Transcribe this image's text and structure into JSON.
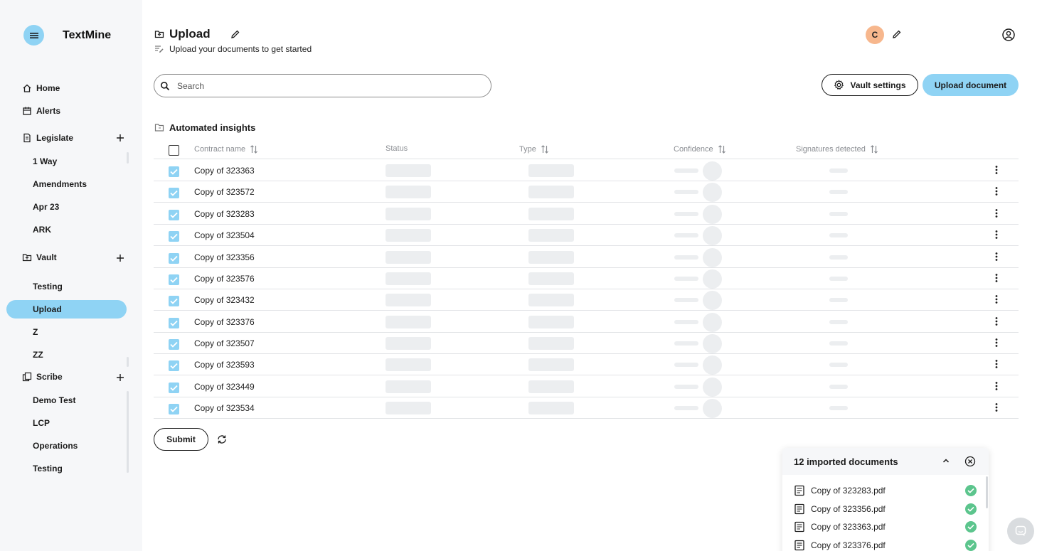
{
  "app": {
    "name": "TextMine"
  },
  "sidebar": {
    "home": "Home",
    "alerts": "Alerts",
    "legislate": {
      "label": "Legislate",
      "items": [
        "1 Way",
        "Amendments",
        "Apr 23",
        "ARK"
      ]
    },
    "vault": {
      "label": "Vault",
      "items": [
        "Testing",
        "Upload",
        "Z",
        "ZZ"
      ],
      "active": "Upload"
    },
    "scribe": {
      "label": "Scribe",
      "items": [
        "Demo Test",
        "LCP",
        "Operations",
        "Testing"
      ]
    }
  },
  "header": {
    "title": "Upload",
    "subtitle": "Upload your documents to get started",
    "avatar_initial": "C"
  },
  "search": {
    "placeholder": "Search"
  },
  "actions": {
    "vault_settings": "Vault settings",
    "upload_document": "Upload document"
  },
  "section": {
    "title": "Automated insights"
  },
  "table": {
    "columns": [
      "Contract name",
      "Status",
      "Type",
      "Confidence",
      "Signatures detected"
    ],
    "rows": [
      "Copy of 323363",
      "Copy of 323572",
      "Copy of 323283",
      "Copy of 323504",
      "Copy of 323356",
      "Copy of 323576",
      "Copy of 323432",
      "Copy of 323376",
      "Copy of 323507",
      "Copy of 323593",
      "Copy of 323449",
      "Copy of 323534"
    ]
  },
  "submit": "Submit",
  "imports": {
    "title": "12 imported documents",
    "files": [
      "Copy of 323283.pdf",
      "Copy of 323356.pdf",
      "Copy of 323363.pdf",
      "Copy of 323376.pdf"
    ]
  },
  "colors": {
    "accent": "#8fd3f4",
    "avatar": "#f7b78d",
    "success": "#5cc58d",
    "sidebar_bg": "#f6f7f9"
  }
}
